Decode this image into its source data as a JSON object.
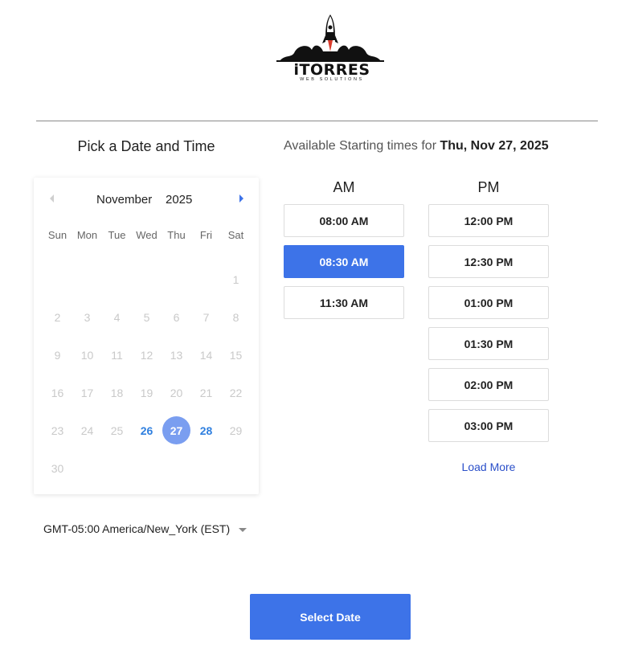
{
  "brand": {
    "name": "iTORRES",
    "tagline": "WEB SOLUTIONS"
  },
  "header": {
    "pick_title": "Pick a Date and Time",
    "available_prefix": "Available Starting times for",
    "available_date": "Thu, Nov 27, 2025"
  },
  "calendar": {
    "month": "November",
    "year": "2025",
    "prev_icon": "chevron-left-icon",
    "next_icon": "chevron-right-icon",
    "weekdays": [
      "Sun",
      "Mon",
      "Tue",
      "Wed",
      "Thu",
      "Fri",
      "Sat"
    ],
    "weeks": [
      [
        "",
        "",
        "",
        "",
        "",
        "",
        "1"
      ],
      [
        "2",
        "3",
        "4",
        "5",
        "6",
        "7",
        "8"
      ],
      [
        "9",
        "10",
        "11",
        "12",
        "13",
        "14",
        "15"
      ],
      [
        "16",
        "17",
        "18",
        "19",
        "20",
        "21",
        "22"
      ],
      [
        "23",
        "24",
        "25",
        "26",
        "27",
        "28",
        "29"
      ],
      [
        "30",
        "",
        "",
        "",
        "",
        "",
        ""
      ]
    ],
    "available_days": [
      "26",
      "27",
      "28"
    ],
    "selected_day": "27"
  },
  "times": {
    "am_label": "AM",
    "pm_label": "PM",
    "am": [
      "08:00 AM",
      "08:30 AM",
      "11:30 AM"
    ],
    "pm": [
      "12:00 PM",
      "12:30 PM",
      "01:00 PM",
      "01:30 PM",
      "02:00 PM",
      "03:00 PM"
    ],
    "selected": "08:30 AM",
    "load_more": "Load More"
  },
  "timezone": {
    "value": "GMT-05:00 America/New_York (EST)"
  },
  "actions": {
    "select_date": "Select Date"
  },
  "colors": {
    "accent": "#3d73e8",
    "selected_day": "#7a9ef0",
    "available_day": "#2f7fdf",
    "link": "#2a4fc9"
  }
}
